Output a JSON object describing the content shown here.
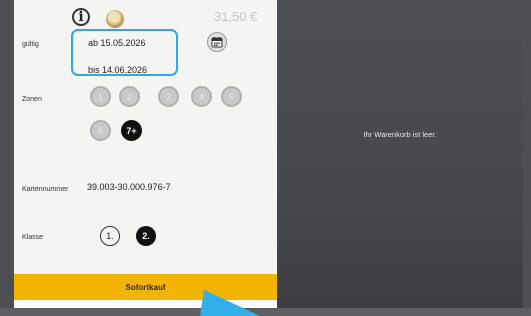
{
  "header": {
    "info_symbol": "i",
    "price": "31,50 €"
  },
  "validity": {
    "label": "gültig",
    "from": "ab 15.05.2026",
    "to": "bis 14.06.2026"
  },
  "zones": {
    "label": "Zonen",
    "items": [
      {
        "label": "1",
        "selected": false
      },
      {
        "label": "2",
        "selected": false
      },
      {
        "label": "3",
        "selected": false
      },
      {
        "label": "4",
        "selected": false
      },
      {
        "label": "5",
        "selected": false
      },
      {
        "label": "6",
        "selected": false
      },
      {
        "label": "7+",
        "selected": true
      }
    ]
  },
  "card": {
    "label": "Kartennummer",
    "number": "39.003-30.000.976-7"
  },
  "class_select": {
    "label": "Klasse",
    "options": [
      {
        "label": "1.",
        "selected": false
      },
      {
        "label": "2.",
        "selected": true
      }
    ]
  },
  "buy_button": "Sofortkauf",
  "cart": {
    "empty_message": "Ihr Warenkorb ist leer."
  },
  "colors": {
    "accent_yellow": "#f1b400",
    "highlight_blue": "#31a7e6",
    "cart_bg": "#4d4f53"
  },
  "icons": [
    "info-icon",
    "coin-icon",
    "calendar-icon"
  ]
}
